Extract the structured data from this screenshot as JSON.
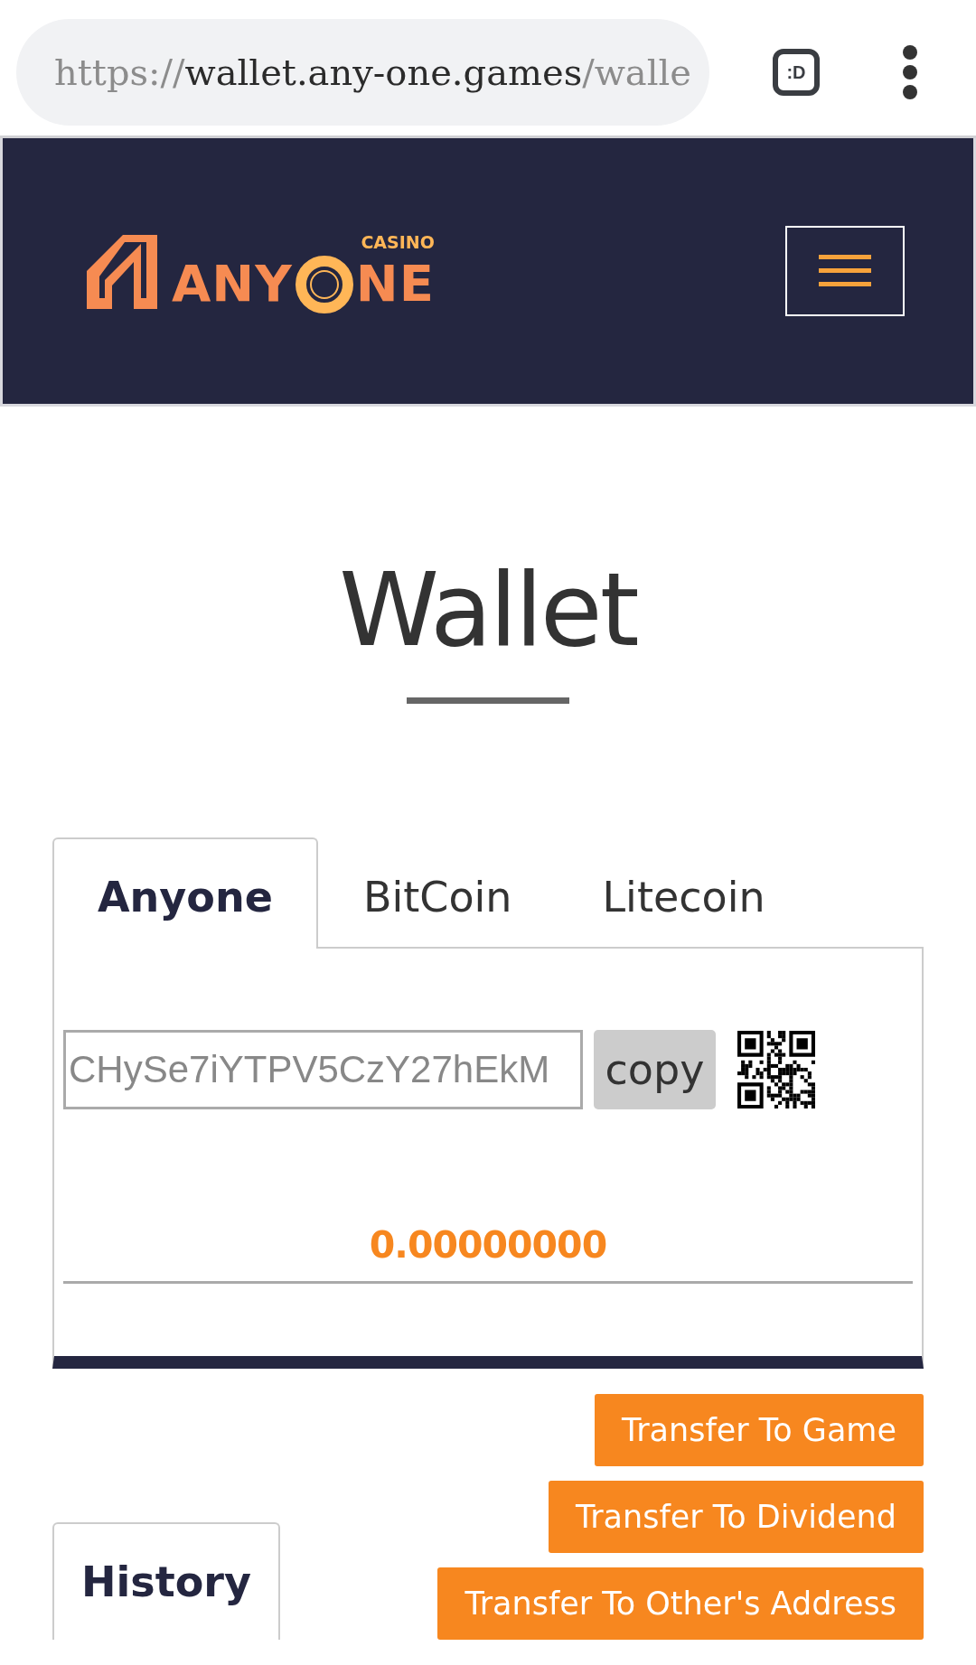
{
  "browser": {
    "url_parts": [
      {
        "text": "https://",
        "dim": true
      },
      {
        "text": "wallet.any-one.games",
        "dim": false
      },
      {
        "text": "/walle",
        "dim": true
      }
    ],
    "badge": ":D"
  },
  "logo": {
    "casino": "CASINO",
    "left": "ANY",
    "right": "NE"
  },
  "heading": "Wallet",
  "tabs": [
    {
      "label": "Anyone",
      "selected": true
    },
    {
      "label": "BitCoin",
      "selected": false
    },
    {
      "label": "Litecoin",
      "selected": false
    }
  ],
  "address": {
    "value": "CHySe7iYTPV5CzY27hEkM",
    "copy_label": "copy"
  },
  "balance": "0.00000000",
  "buttons": [
    "Transfer To Game",
    "Transfer To Dividend",
    "Transfer To Other's Address"
  ],
  "history_tab": {
    "label": "History",
    "selected": true
  }
}
